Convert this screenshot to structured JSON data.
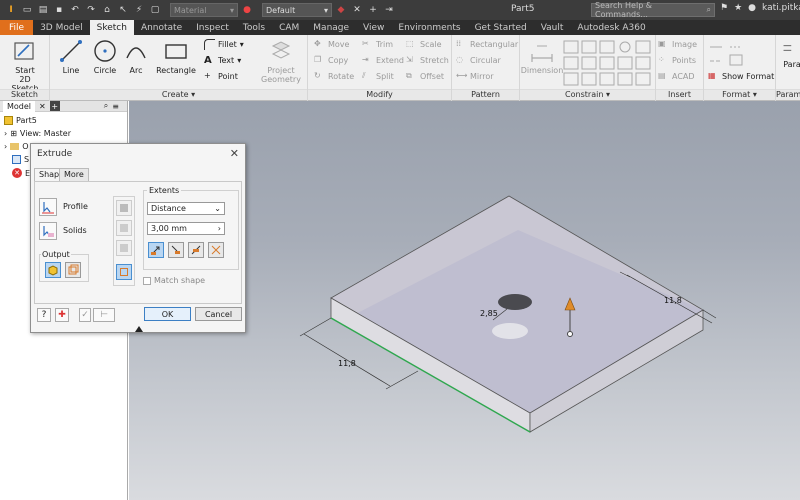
{
  "window": {
    "document_title": "Part5",
    "user": "kati.pitkan"
  },
  "quick_access": {
    "material": "Material",
    "appearance": "Default"
  },
  "search": {
    "placeholder": "Search Help & Commands..."
  },
  "tabs": [
    {
      "label": "File"
    },
    {
      "label": "3D Model"
    },
    {
      "label": "Sketch"
    },
    {
      "label": "Annotate"
    },
    {
      "label": "Inspect"
    },
    {
      "label": "Tools"
    },
    {
      "label": "CAM"
    },
    {
      "label": "Manage"
    },
    {
      "label": "View"
    },
    {
      "label": "Environments"
    },
    {
      "label": "Get Started"
    },
    {
      "label": "Vault"
    },
    {
      "label": "Autodesk A360"
    }
  ],
  "ribbon": {
    "sketch_panel": {
      "title": "Sketch",
      "start": "Start\n2D Sketch"
    },
    "create_panel": {
      "title": "Create",
      "line": "Line",
      "circle": "Circle",
      "arc": "Arc",
      "rectangle": "Rectangle",
      "fillet": "Fillet",
      "text": "Text",
      "point": "Point"
    },
    "project": {
      "label": "Project\nGeometry"
    },
    "modify_panel": {
      "title": "Modify",
      "move": "Move",
      "copy": "Copy",
      "rotate": "Rotate",
      "trim": "Trim",
      "extend": "Extend",
      "split": "Split",
      "scale": "Scale",
      "stretch": "Stretch",
      "offset": "Offset"
    },
    "pattern_panel": {
      "title": "Pattern",
      "rectangular": "Rectangular",
      "circular": "Circular",
      "mirror": "Mirror"
    },
    "dimension": {
      "label": "Dimension"
    },
    "constrain_panel": {
      "title": "Constrain"
    },
    "insert_panel": {
      "title": "Insert",
      "image": "Image",
      "points": "Points",
      "acad": "ACAD"
    },
    "format_panel": {
      "title": "Format",
      "show_format": "Show Format"
    },
    "param_panel": {
      "title": "Param",
      "para": "Para"
    }
  },
  "browser": {
    "tab": "Model",
    "items": [
      {
        "label": "Part5"
      },
      {
        "label": "View: Master"
      },
      {
        "label": "O"
      },
      {
        "label": "S"
      },
      {
        "label": "E"
      }
    ]
  },
  "dialog": {
    "title": "Extrude",
    "tabs": [
      {
        "label": "Shape"
      },
      {
        "label": "More"
      }
    ],
    "profile_label": "Profile",
    "solids_label": "Solids",
    "output_label": "Output",
    "extents_label": "Extents",
    "extents_type": "Distance",
    "distance_value": "3,00 mm",
    "match_shape": "Match shape",
    "ok": "OK",
    "cancel": "Cancel"
  },
  "model": {
    "dim_width": "11,8",
    "dim_depth": "11,8",
    "hole_dim": "2,85"
  }
}
